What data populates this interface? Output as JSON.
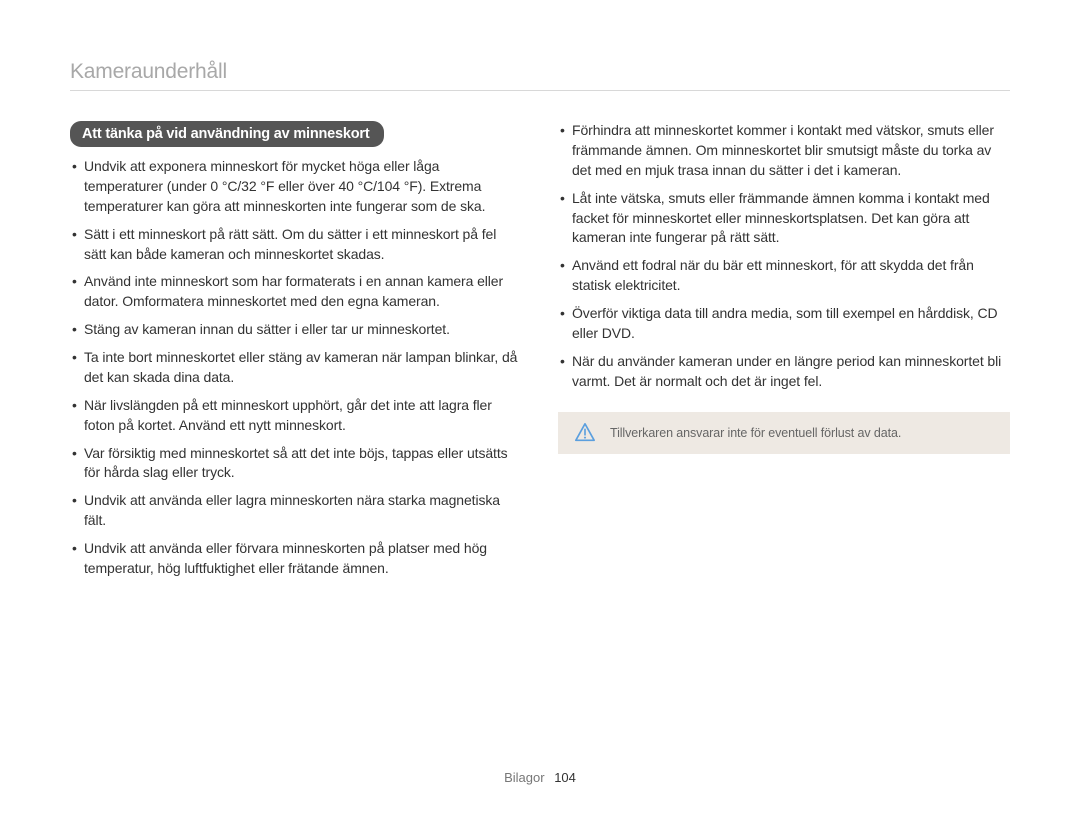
{
  "title": "Kameraunderhåll",
  "section_heading": "Att tänka på vid användning av minneskort",
  "left_bullets": [
    "Undvik att exponera minneskort för mycket höga eller låga temperaturer (under 0 °C/32 °F eller över 40 °C/104 °F). Extrema temperaturer kan göra att minneskorten inte fungerar som de ska.",
    "Sätt i ett minneskort på rätt sätt. Om du sätter i ett minneskort på fel sätt kan både kameran och minneskortet skadas.",
    "Använd inte minneskort som har formaterats i en annan kamera eller dator. Omformatera minneskortet med den egna kameran.",
    "Stäng av kameran innan du sätter i eller tar ur minneskortet.",
    "Ta inte bort minneskortet eller stäng av kameran när lampan blinkar, då det kan skada dina data.",
    "När livslängden på ett minneskort upphört, går det inte att lagra fler foton på kortet. Använd ett nytt minneskort.",
    "Var försiktig med minneskortet så att det inte böjs, tappas eller utsätts för hårda slag eller tryck.",
    "Undvik att använda eller lagra minneskorten nära starka magnetiska fält.",
    "Undvik att använda eller förvara minneskorten på platser med hög temperatur, hög luftfuktighet eller frätande ämnen."
  ],
  "right_bullets": [
    "Förhindra att minneskortet kommer i kontakt med vätskor, smuts eller främmande ämnen. Om minneskortet blir smutsigt måste du torka av det med en mjuk trasa innan du sätter i det i kameran.",
    "Låt inte vätska, smuts eller främmande ämnen komma i kontakt med facket för minneskortet eller minneskortsplatsen. Det kan göra att kameran inte fungerar på rätt sätt.",
    "Använd ett fodral när du bär ett minneskort, för att skydda det från statisk elektricitet.",
    "Överför viktiga data till andra media, som till exempel en hårddisk, CD eller DVD.",
    "När du använder kameran under en längre period kan minneskortet bli varmt. Det är normalt och det är inget fel."
  ],
  "notice_text": "Tillverkaren ansvarar inte för eventuell förlust av data.",
  "footer": {
    "label": "Bilagor",
    "page": "104"
  }
}
